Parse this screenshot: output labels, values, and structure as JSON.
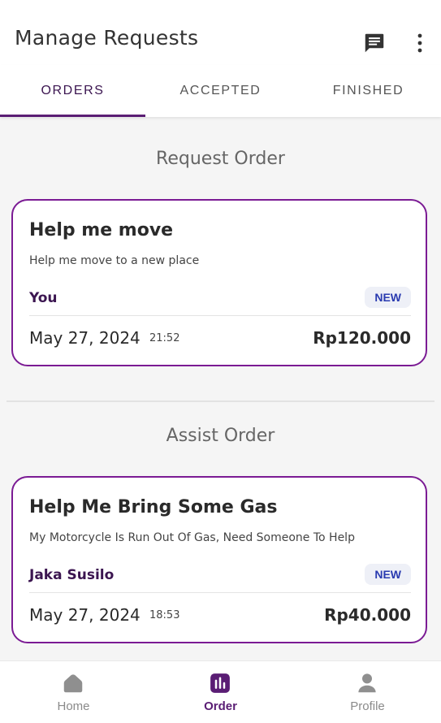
{
  "appbar": {
    "title": "Manage Requests",
    "icons": [
      "chat-icon",
      "more-vert-icon"
    ]
  },
  "tabs": [
    {
      "label": "ORDERS",
      "active": true
    },
    {
      "label": "ACCEPTED",
      "active": false
    },
    {
      "label": "FINISHED",
      "active": false
    }
  ],
  "sections": {
    "request_title": "Request Order",
    "assist_title": "Assist Order"
  },
  "request_card": {
    "title": "Help me move",
    "description": "Help me move to a new place",
    "user": "You",
    "badge": "NEW",
    "date": "May 27, 2024",
    "time": "21:52",
    "price": "Rp120.000"
  },
  "assist_card": {
    "title": "Help Me Bring Some Gas",
    "description": "My Motorcycle Is Run Out Of Gas, Need Someone To Help",
    "user": "Jaka Susilo",
    "badge": "NEW",
    "date": "May 27, 2024",
    "time": "18:53",
    "price": "Rp40.000"
  },
  "bottom_nav": [
    {
      "label": "Home",
      "icon": "home-icon",
      "active": false
    },
    {
      "label": "Order",
      "icon": "order-icon",
      "active": true
    },
    {
      "label": "Profile",
      "icon": "profile-icon",
      "active": false
    }
  ],
  "colors": {
    "accent": "#5a1d74",
    "card_border": "#7b1b94",
    "badge_text": "#2a3bb0",
    "badge_bg": "#eef0f7"
  }
}
